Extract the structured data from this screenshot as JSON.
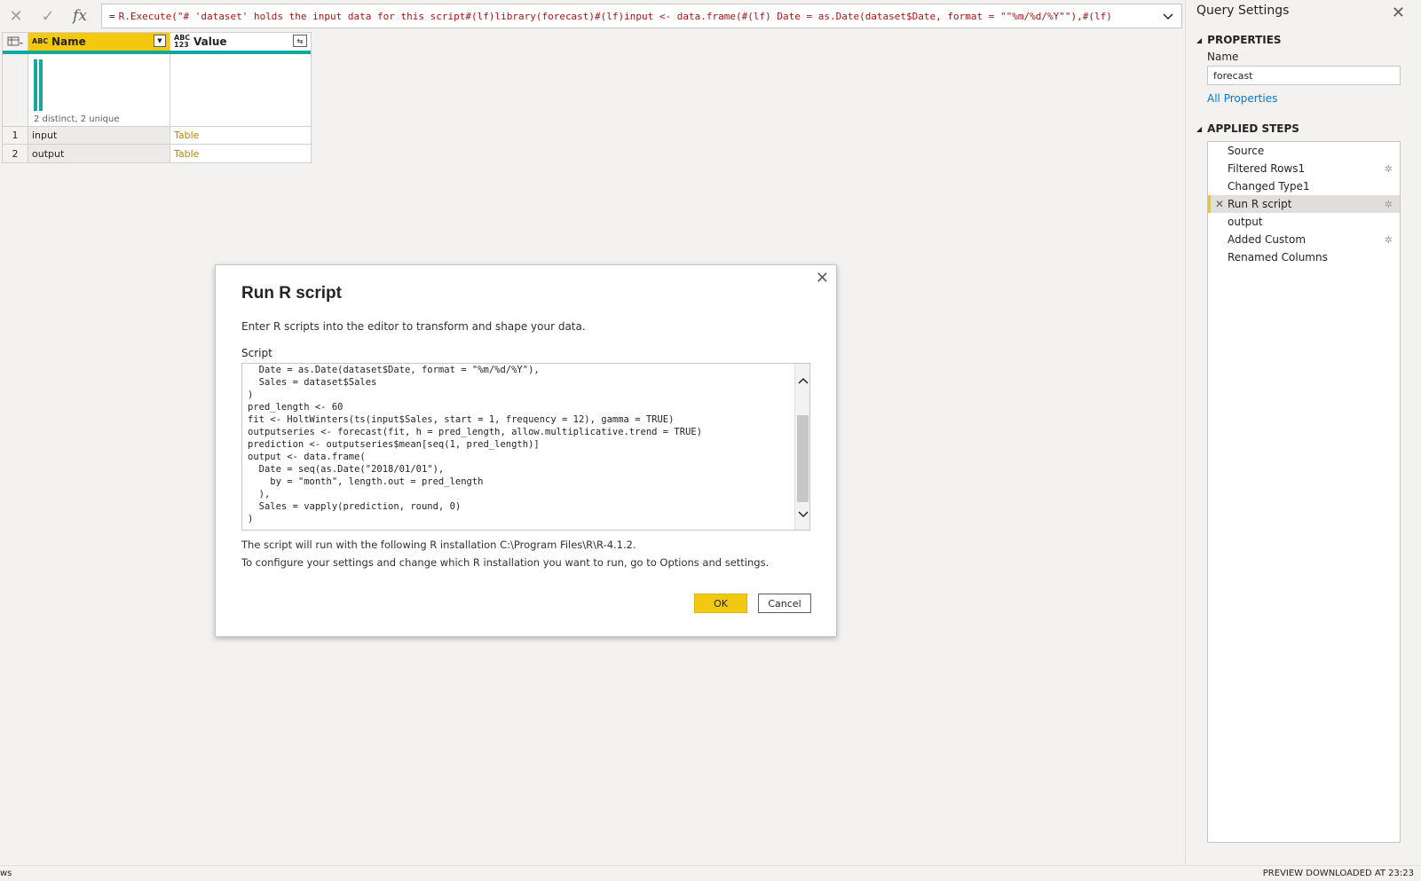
{
  "formula_bar": {
    "prefix": "=",
    "text": "R.Execute(\"# 'dataset' holds the input data for this script#(lf)library(forecast)#(lf)input <- data.frame(#(lf)  Date = as.Date(dataset$Date, format = \"\"%m/%d/%Y\"\"),#(lf)"
  },
  "grid": {
    "columns": [
      {
        "type_icon": "ABC",
        "name": "Name"
      },
      {
        "type_icon": "ABC 123",
        "name": "Value"
      }
    ],
    "quality_text": "2 distinct, 2 unique",
    "rows": [
      {
        "num": "1",
        "name": "input",
        "value": "Table"
      },
      {
        "num": "2",
        "name": "output",
        "value": "Table"
      }
    ]
  },
  "query_settings": {
    "title": "Query Settings",
    "properties_header": "PROPERTIES",
    "name_label": "Name",
    "name_value": "forecast",
    "all_properties": "All Properties",
    "applied_steps_header": "APPLIED STEPS",
    "steps": [
      {
        "label": "Source",
        "gear": false,
        "selected": false
      },
      {
        "label": "Filtered Rows1",
        "gear": true,
        "selected": false
      },
      {
        "label": "Changed Type1",
        "gear": false,
        "selected": false
      },
      {
        "label": "Run R script",
        "gear": true,
        "selected": true
      },
      {
        "label": "output",
        "gear": false,
        "selected": false
      },
      {
        "label": "Added Custom",
        "gear": true,
        "selected": false
      },
      {
        "label": "Renamed Columns",
        "gear": false,
        "selected": false
      }
    ]
  },
  "dialog": {
    "title": "Run R script",
    "description": "Enter R scripts into the editor to transform and shape your data.",
    "script_label": "Script",
    "script": "  Date = as.Date(dataset$Date, format = \"%m/%d/%Y\"),\n  Sales = dataset$Sales\n)\npred_length <- 60\nfit <- HoltWinters(ts(input$Sales, start = 1, frequency = 12), gamma = TRUE)\noutputseries <- forecast(fit, h = pred_length, allow.multiplicative.trend = TRUE)\nprediction <- outputseries$mean[seq(1, pred_length)]\noutput <- data.frame(\n  Date = seq(as.Date(\"2018/01/01\"),\n    by = \"month\", length.out = pred_length\n  ),\n  Sales = vapply(prediction, round, 0)\n)",
    "info_install": "The script will run with the following R installation C:\\Program Files\\R\\R-4.1.2.",
    "info_configure": "To configure your settings and change which R installation you want to run, go to Options and settings.",
    "ok_label": "OK",
    "cancel_label": "Cancel"
  },
  "status_bar": {
    "left": "ws",
    "right": "PREVIEW DOWNLOADED AT 23:23"
  },
  "colors": {
    "accent_yellow": "#f2c811",
    "quality_teal": "#12a89d",
    "link_blue": "#0078d4",
    "table_value": "#b8860b"
  }
}
